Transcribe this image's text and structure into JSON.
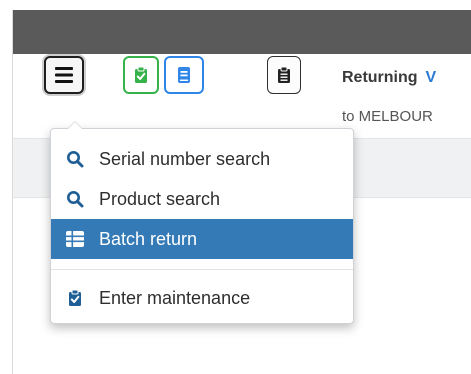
{
  "colors": {
    "titlebar": "#5a5a5a",
    "accent_green": "#36b24a",
    "accent_blue": "#2f86e8",
    "menu_active_bg": "#337ab7",
    "return_highlight": "#2b7bd6"
  },
  "toolbar": {
    "menu_button_icon": "hamburger-icon",
    "green_button_icon": "clipboard-check-icon",
    "blue_button_icon": "book-icon",
    "clip_button_icon": "clipboard-list-icon"
  },
  "header": {
    "returning_label": "Returning",
    "returning_highlight": "V",
    "destination": "to MELBOUR"
  },
  "menu": {
    "items": [
      {
        "label": "Serial number search",
        "icon": "search-icon"
      },
      {
        "label": "Product search",
        "icon": "search-icon"
      },
      {
        "label": "Batch return",
        "icon": "table-icon",
        "active": true
      },
      {
        "label": "Enter maintenance",
        "icon": "clipboard-check-icon"
      }
    ]
  }
}
